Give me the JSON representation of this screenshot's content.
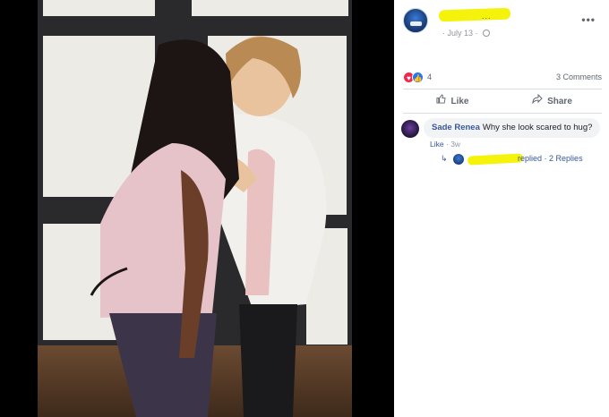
{
  "post": {
    "author_name": "",
    "author_name_tail": "...",
    "date": "July 13",
    "meta_separator": "·",
    "reaction_count": "4",
    "comments_label": "3 Comments"
  },
  "actions": {
    "like_label": "Like",
    "share_label": "Share"
  },
  "comment": {
    "author": "Sade Renea",
    "text": "Why she look scared to hug?",
    "like_label": "Like",
    "separator": "·",
    "age": "3w",
    "replied_label": "replied",
    "replies_label": "· 2 Replies"
  },
  "icons": {
    "more": "more-options-icon",
    "privacy": "globe-icon",
    "love": "love-reaction-icon",
    "like": "like-reaction-icon",
    "like_action": "thumbs-up-icon",
    "share_action": "share-arrow-icon",
    "reply": "reply-arrow-icon"
  },
  "colors": {
    "link_blue": "#385898",
    "redaction_yellow": "#f5f20c",
    "love_red": "#f0284a",
    "like_blue": "#2078f4"
  }
}
